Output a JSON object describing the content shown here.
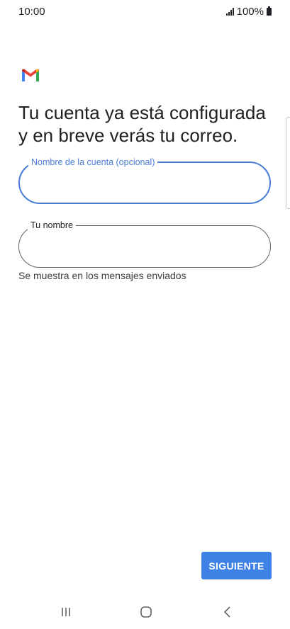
{
  "status_bar": {
    "time": "10:00",
    "battery": "100%"
  },
  "app": {
    "logo_icon": "gmail-logo-icon",
    "title": "Tu cuenta ya está configurada y en breve verás tu correo."
  },
  "form": {
    "account_name": {
      "label": "Nombre de la cuenta (opcional)",
      "value": ""
    },
    "your_name": {
      "label": "Tu nombre",
      "value": "",
      "helper": "Se muestra en los mensajes enviados"
    }
  },
  "actions": {
    "next_label": "SIGUIENTE"
  },
  "nav_bar": {
    "icons": [
      "recents-icon",
      "home-icon",
      "back-icon"
    ]
  },
  "colors": {
    "accent": "#4a7dd6",
    "button": "#3f82e6",
    "text": "#202124"
  }
}
